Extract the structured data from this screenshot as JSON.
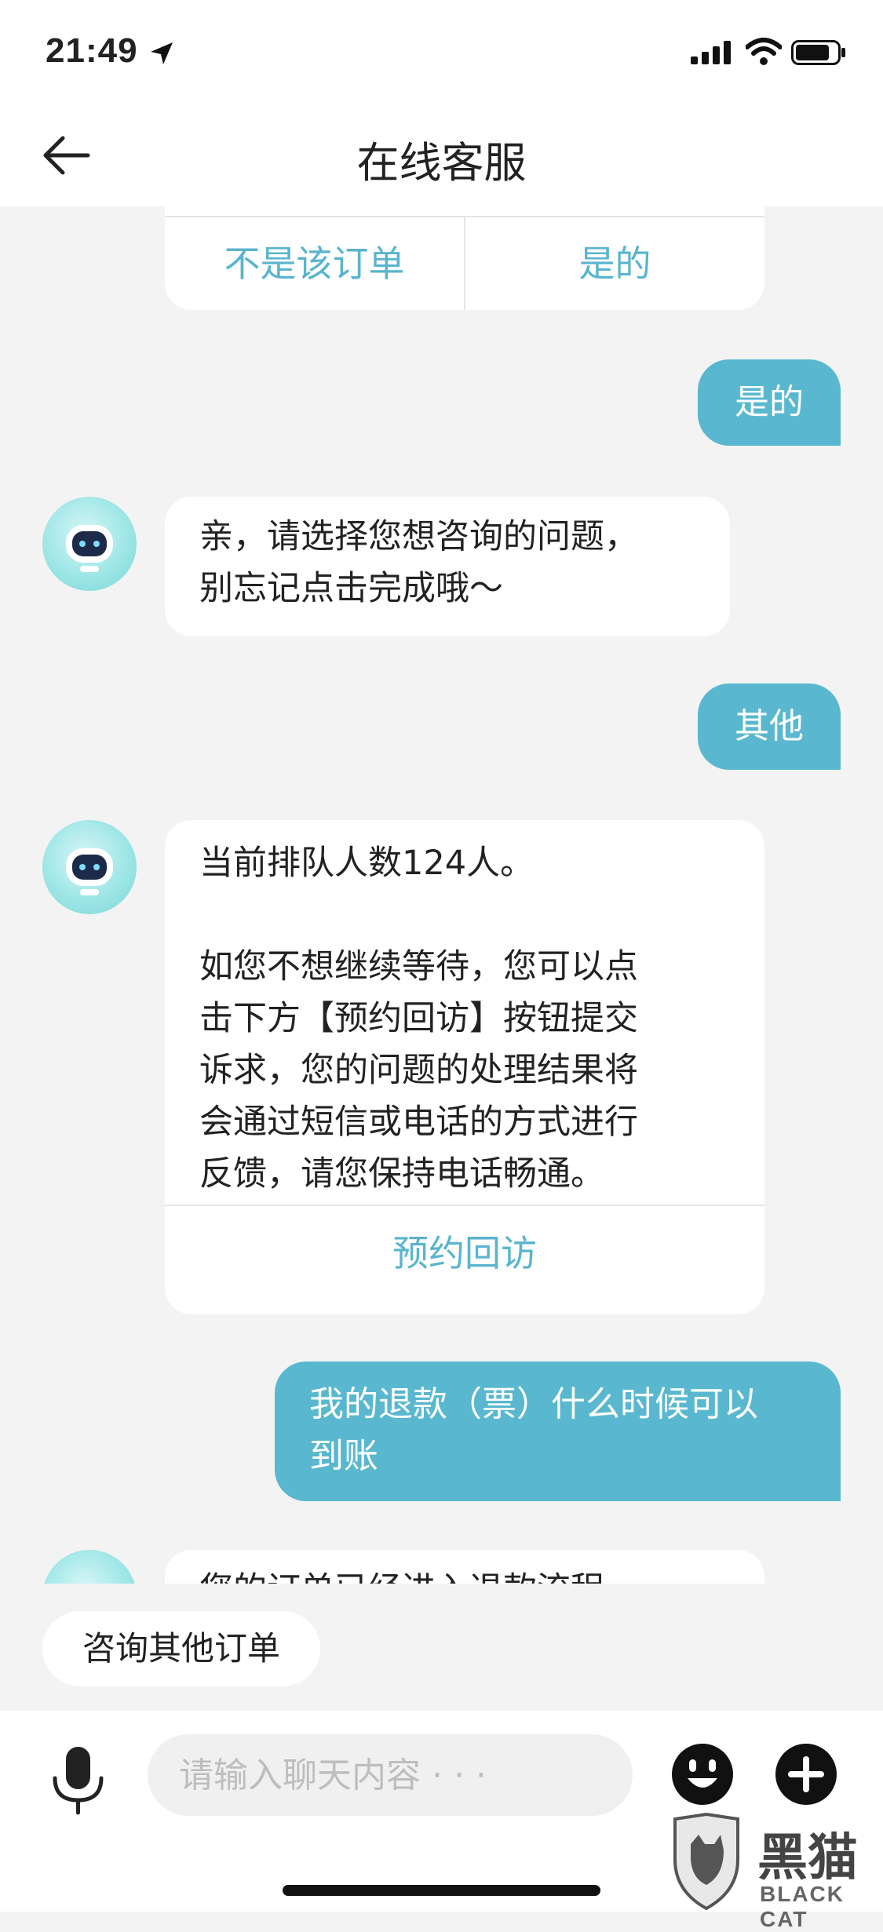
{
  "status_bar": {
    "time": "21:49"
  },
  "header": {
    "title": "在线客服"
  },
  "order_card": {
    "option_no": "不是该订单",
    "option_yes": "是的"
  },
  "messages": {
    "user_1": "是的",
    "bot_1_line1": "亲，请选择您想咨询的问题，",
    "bot_1_line2": "别忘记点击完成哦～",
    "user_2": "其他",
    "bot_2_line1": "当前排队人数124人。",
    "bot_2_line2": "如您不想继续等待，您可以点",
    "bot_2_line3": "击下方【预约回访】按钮提交",
    "bot_2_line4": "诉求，您的问题的处理结果将",
    "bot_2_line5": "会通过短信或电话的方式进行",
    "bot_2_line6": "反馈，请您保持电话畅通。",
    "bot_2_action": "预约回访",
    "user_3_line1": "我的退款（票）什么时候可以",
    "user_3_line2": "到账",
    "bot_3_partial": "您的订单已经进入退款流程"
  },
  "quick_reply": {
    "label": "咨询其他订单"
  },
  "input_bar": {
    "placeholder": "请输入聊天内容 · · ·"
  },
  "watermark": {
    "brand": "黑猫",
    "sub": "BLACK CAT"
  },
  "colors": {
    "accent": "#59b8cf",
    "background": "#f3f3f3"
  },
  "icons": [
    "back-arrow-icon",
    "location-arrow-icon",
    "signal-icon",
    "wifi-icon",
    "battery-icon",
    "robot-avatar-icon",
    "microphone-icon",
    "emoji-icon",
    "plus-icon"
  ]
}
